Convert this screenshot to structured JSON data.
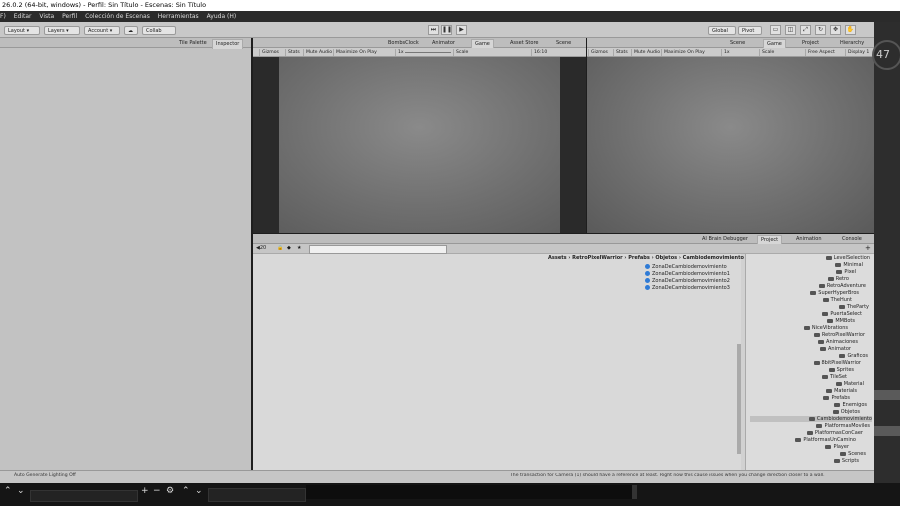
{
  "window": {
    "title": "26.0.2 (64-bit, windows) - Perfil: Sin Título - Escenas: Sin Título"
  },
  "menu": [
    "F)",
    "Editar",
    "Vista",
    "Perfil",
    "Colección de Escenas",
    "Herramientas",
    "Ayuda (H)"
  ],
  "toolbar": {
    "layout": "Layout",
    "layers": "Layers",
    "account": "Account",
    "collab": "Collab",
    "global": "Global",
    "pivot": "Pivot"
  },
  "left_panel": {
    "tabs": [
      "Tile Palette",
      "Inspector"
    ]
  },
  "game_view_left": {
    "tabs": [
      "BombsClock",
      "Animator",
      "Game",
      "Asset Store",
      "Scene"
    ],
    "controls": [
      "Gizmos",
      "Stats",
      "Mute Audio",
      "Maximize On Play",
      "1x",
      "Scale",
      "16:10"
    ]
  },
  "game_view_right": {
    "tabs": [
      "Hierarchy",
      "Project",
      "Game",
      "Scene"
    ],
    "controls": [
      "Display 1",
      "Free Aspect",
      "Scale",
      "1x",
      "Maximize On Play",
      "Mute Audio",
      "Stats",
      "Gizmos",
      "Display 1"
    ]
  },
  "bottom_panel": {
    "tabs": [
      "Console",
      "Animation",
      "Project",
      "AI Brain Debugger"
    ],
    "search_placeholder": "",
    "breadcrumb": [
      "Assets",
      "RetroPixelWarrior",
      "Prefabs",
      "Objetos",
      "Cambiodemovimiento"
    ],
    "count": "20",
    "assets": [
      "ZonaDeCambiodemovimiento",
      "ZonaDeCambiodemovimiento1",
      "ZonaDeCambiodemovimiento2",
      "ZonaDeCambiodemovimiento3"
    ],
    "tree": [
      "LevelSelection",
      "Minimal",
      "Pixel",
      "Retro",
      "RetroAdventure",
      "SuperHyperBros",
      "TheHunt",
      "TheParty",
      "PuertaSelect",
      "MMBots",
      "NiceVibrations",
      "RetroPixelWarrior",
      "Animaciones",
      "Animator",
      "Graficos",
      "8bitPixelWarrior",
      "Sprites",
      "TileSet",
      "Material",
      "Materials",
      "Prefabs",
      "Enemigos",
      "Objetos",
      "Cambiodemovimiento",
      "PlatformasMoviles",
      "PlatformasConCaer",
      "PlatformasUnCamino",
      "Player",
      "Scenes",
      "Scripts"
    ],
    "status": "The transaction for Camera (1) should have a reference at least. Right now this cause issues when you change direction closer to a wall."
  },
  "status_strip": {
    "left": "Auto Generate Lighting Off"
  },
  "right_overlay": {
    "fps": "47"
  }
}
